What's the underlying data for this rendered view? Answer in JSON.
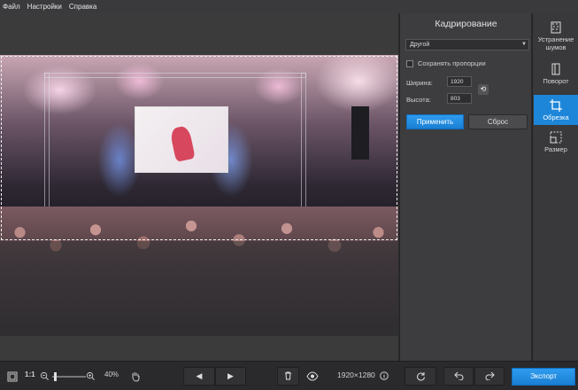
{
  "menu": [
    "Файл",
    "Настройки",
    "Справка"
  ],
  "panel": {
    "title": "Кадрирование",
    "preset": "Другой",
    "keep_ratio_label": "Сохранять пропорции",
    "keep_ratio_checked": false,
    "width_label": "Ширина:",
    "width_value": "1920",
    "height_label": "Высота:",
    "height_value": "803",
    "apply_label": "Применить",
    "reset_label": "Сброс"
  },
  "tools": [
    {
      "label": "Устранение шумов",
      "icon": "denoise-icon",
      "active": false
    },
    {
      "label": "Поворот",
      "icon": "rotate-icon",
      "active": false
    },
    {
      "label": "Обрезка",
      "icon": "crop-icon",
      "active": true
    },
    {
      "label": "Размер",
      "icon": "resize-icon",
      "active": false
    }
  ],
  "bottom": {
    "ratio_label": "1:1",
    "zoom_percent": "40%",
    "image_size": "1920×1280",
    "export_label": "Экспорт"
  },
  "colors": {
    "accent": "#1d86d8",
    "background": "#2b2b2d",
    "panel": "#3d3d3f"
  }
}
